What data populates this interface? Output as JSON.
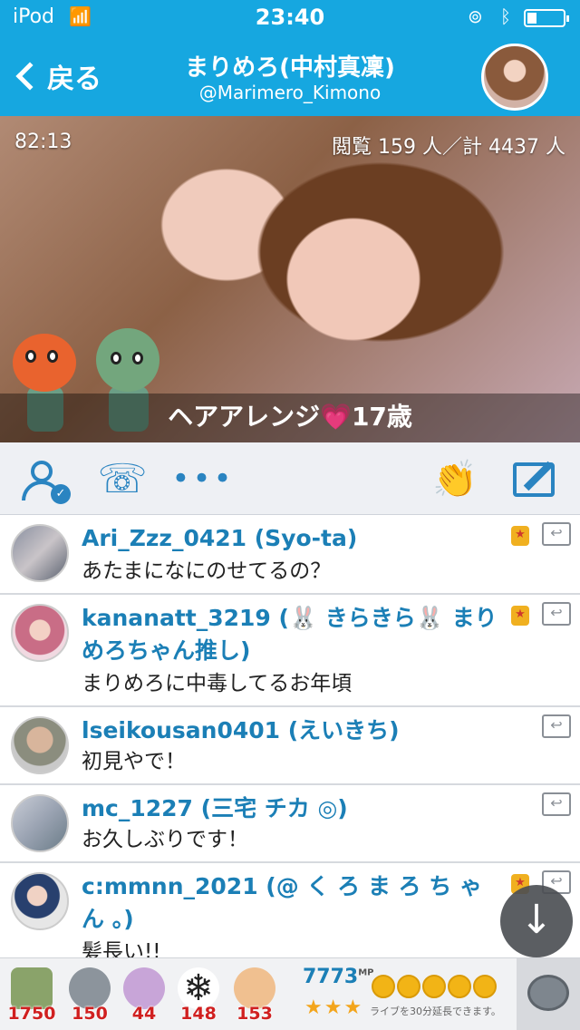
{
  "status_bar": {
    "device": "iPod",
    "time": "23:40"
  },
  "header": {
    "back_label": "戻る",
    "title": "まりめろ(中村真凜)",
    "handle": "@Marimero_Kimono"
  },
  "video": {
    "elapsed": "82:13",
    "viewers": "閲覧 159 人／計 4437 人",
    "caption": "ヘアアレンジ💗17歳"
  },
  "toolbar": {
    "icons": [
      "follow-user-icon",
      "call-icon",
      "more-icon",
      "clap-icon",
      "compose-icon"
    ],
    "more_label": "•••"
  },
  "comments": [
    {
      "name": "Ari_Zzz_0421 (Syo-ta)",
      "text": "あたまになにのせてるの？",
      "badge": true
    },
    {
      "name": "kananatt_3219 (🐰 きらきら🐰 まりめろちゃん推し)",
      "text": "まりめろに中毒してるお年頃",
      "badge": true
    },
    {
      "name": "lseikousan0401 (えいきち)",
      "text": "初見やで！",
      "badge": false
    },
    {
      "name": "mc_1227 (三宅 チカ ◎)",
      "text": "お久しぶりです！",
      "badge": false
    },
    {
      "name": "c:mmnn_2021 (@ く ろ ま ろ ち ゃ ん 。)",
      "text": "髪長い!!",
      "badge": true
    }
  ],
  "gifts": [
    {
      "icon": "tea-icon",
      "count": "1750"
    },
    {
      "icon": "coin-disc-icon",
      "count": "150"
    },
    {
      "icon": "bear-icon",
      "count": "44"
    },
    {
      "icon": "snowflake-icon",
      "count": "148"
    },
    {
      "icon": "clap-hands-icon",
      "count": "153"
    }
  ],
  "points": {
    "value": "7773",
    "unit": "MP",
    "stars": "★★★",
    "extend_note": "ライブを30分延長できます。"
  }
}
